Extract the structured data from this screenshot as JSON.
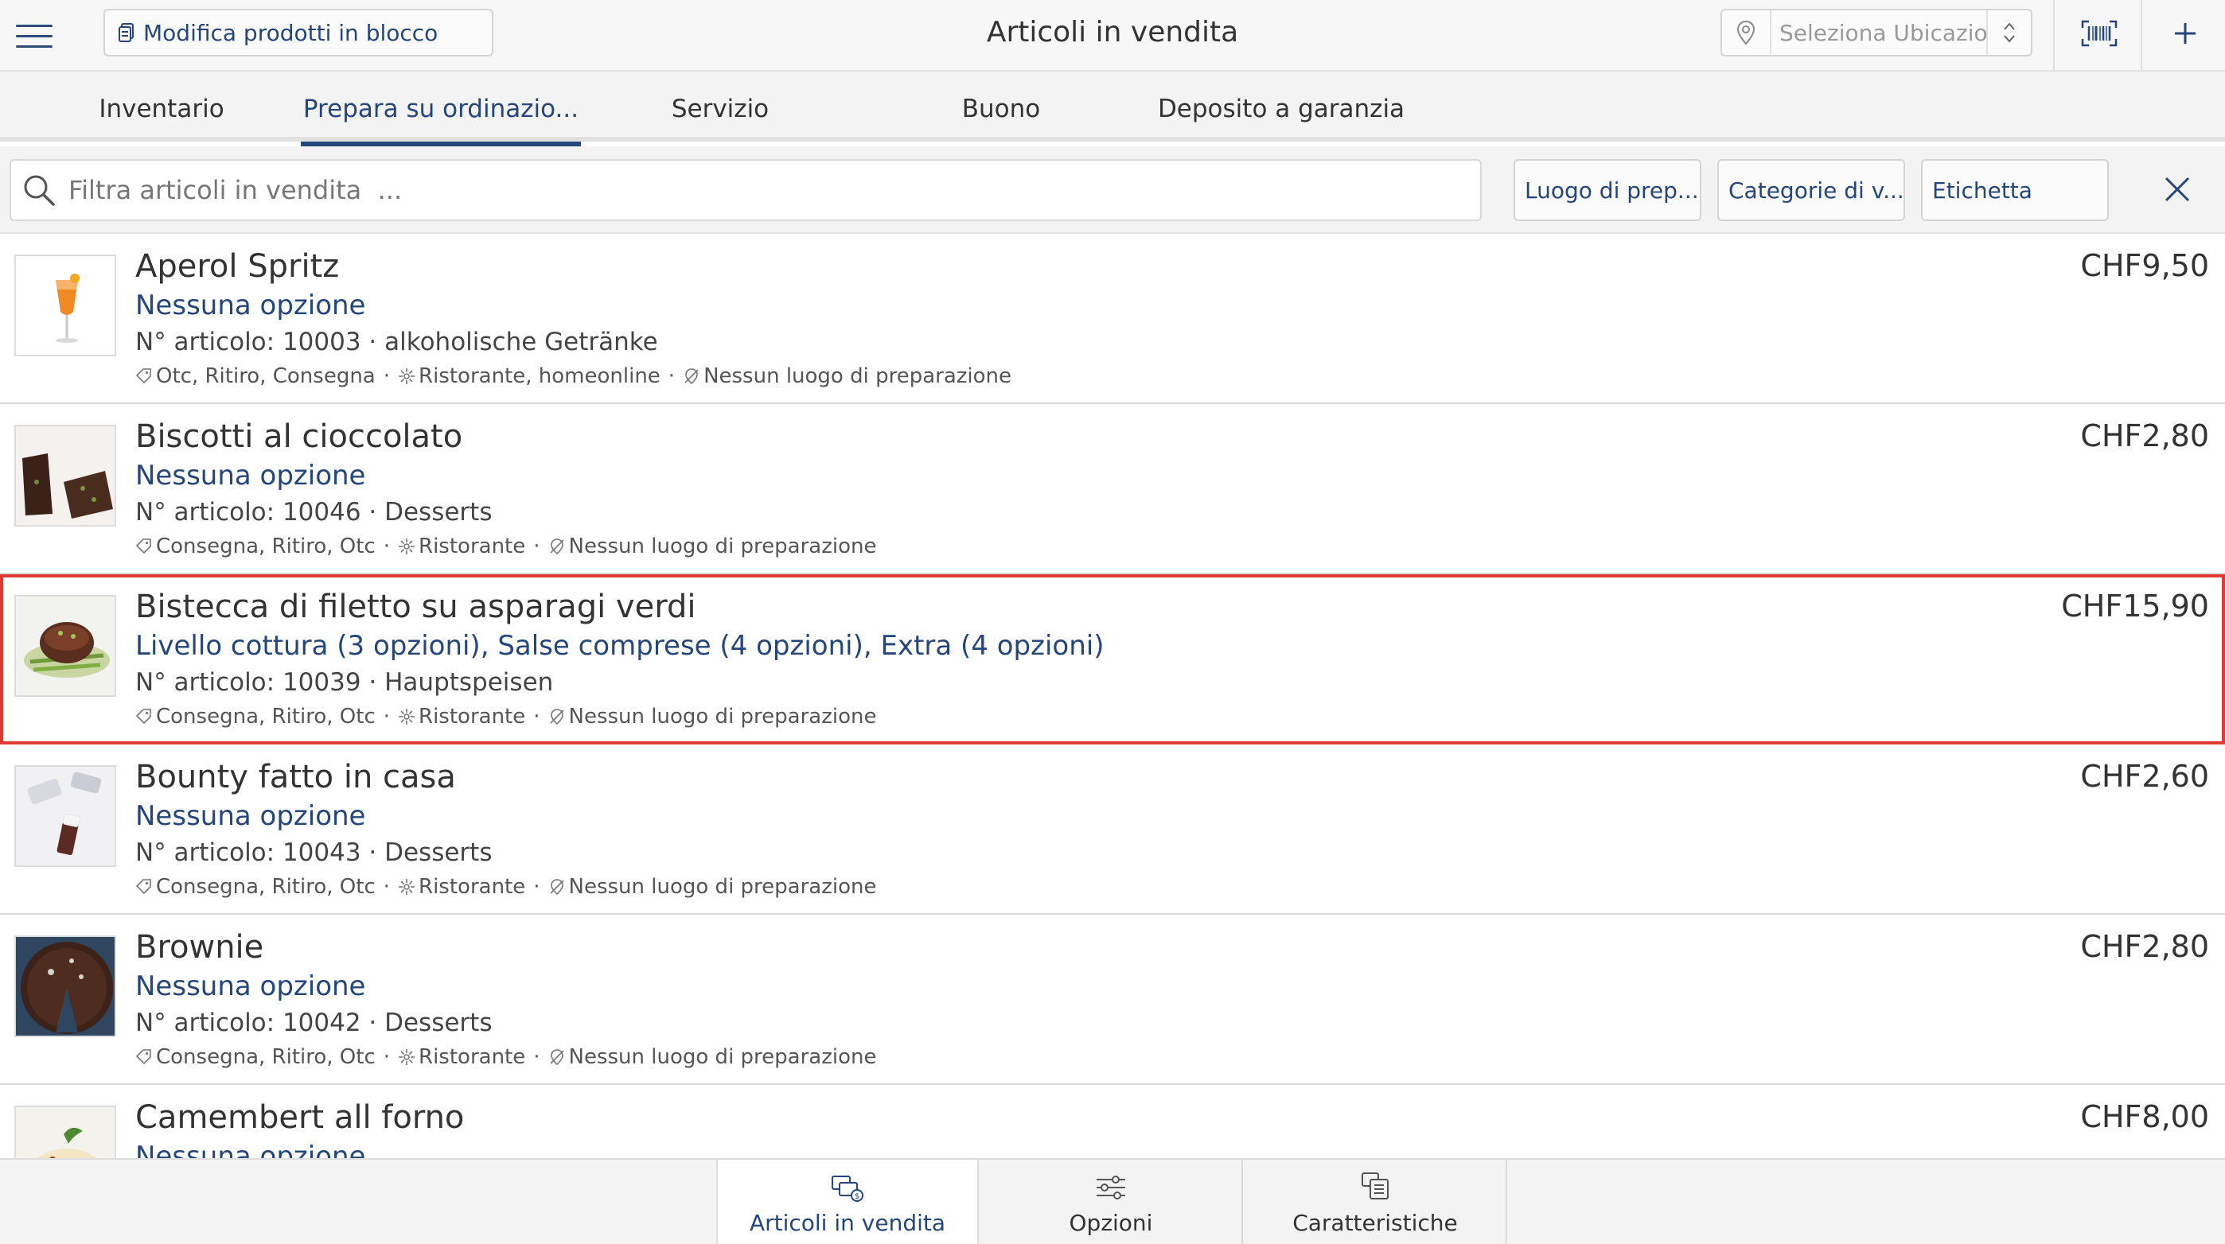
{
  "header": {
    "menu_icon": "hamburger-menu-icon",
    "bulk_edit_label": "Modifica prodotti in blocco",
    "title": "Articoli in vendita",
    "location_placeholder": "Seleziona Ubicazio....",
    "barcode_icon": "barcode-scanner-icon",
    "add_icon": "plus-icon"
  },
  "tabs": [
    {
      "label": "Inventario",
      "active": false
    },
    {
      "label": "Prepara su ordinazio...",
      "active": true
    },
    {
      "label": "Servizio",
      "active": false
    },
    {
      "label": "Buono",
      "active": false
    },
    {
      "label": "Deposito a garanzia",
      "active": false
    }
  ],
  "filters": {
    "search_placeholder": "Filtra articoli in vendita  ...",
    "buttons": [
      "Luogo di prep...",
      "Categorie di v...",
      "Etichetta"
    ],
    "clear_icon": "close-icon"
  },
  "items": [
    {
      "name": "Aperol Spritz",
      "options": "Nessuna opzione",
      "meta": "N° articolo: 10003 · alkoholische Getränke",
      "channels": "Otc, Ritiro, Consegna",
      "sales_points": "Ristorante, homeonline",
      "prep_location": "Nessun luogo di preparazione",
      "price": "CHF9,50",
      "selected": false
    },
    {
      "name": "Biscotti al cioccolato",
      "options": "Nessuna opzione",
      "meta": "N° articolo: 10046 · Desserts",
      "channels": "Consegna, Ritiro, Otc",
      "sales_points": "Ristorante",
      "prep_location": "Nessun luogo di preparazione",
      "price": "CHF2,80",
      "selected": false
    },
    {
      "name": "Bistecca di filetto su asparagi verdi",
      "options": "Livello cottura (3 opzioni), Salse comprese (4 opzioni), Extra (4 opzioni)",
      "meta": "N° articolo: 10039 · Hauptspeisen",
      "channels": "Consegna, Ritiro, Otc",
      "sales_points": "Ristorante",
      "prep_location": "Nessun luogo di preparazione",
      "price": "CHF15,90",
      "selected": true
    },
    {
      "name": "Bounty fatto in casa",
      "options": "Nessuna opzione",
      "meta": "N° articolo: 10043 · Desserts",
      "channels": "Consegna, Ritiro, Otc",
      "sales_points": "Ristorante",
      "prep_location": "Nessun luogo di preparazione",
      "price": "CHF2,60",
      "selected": false
    },
    {
      "name": "Brownie",
      "options": "Nessuna opzione",
      "meta": "N° articolo: 10042 · Desserts",
      "channels": "Consegna, Ritiro, Otc",
      "sales_points": "Ristorante",
      "prep_location": "Nessun luogo di preparazione",
      "price": "CHF2,80",
      "selected": false
    },
    {
      "name": "Camembert all forno",
      "options": "Nessuna opzione",
      "meta": "",
      "channels": "",
      "sales_points": "",
      "prep_location": "",
      "price": "CHF8,00",
      "selected": false
    }
  ],
  "bottom_tabs": [
    {
      "label": "Articoli in vendita",
      "icon": "sales-items-icon",
      "active": true
    },
    {
      "label": "Opzioni",
      "icon": "sliders-icon",
      "active": false
    },
    {
      "label": "Caratteristiche",
      "icon": "characteristics-icon",
      "active": false
    }
  ],
  "colors": {
    "accent": "#24467c",
    "selection_border": "#e03a33",
    "background": "#f3f3f3"
  }
}
